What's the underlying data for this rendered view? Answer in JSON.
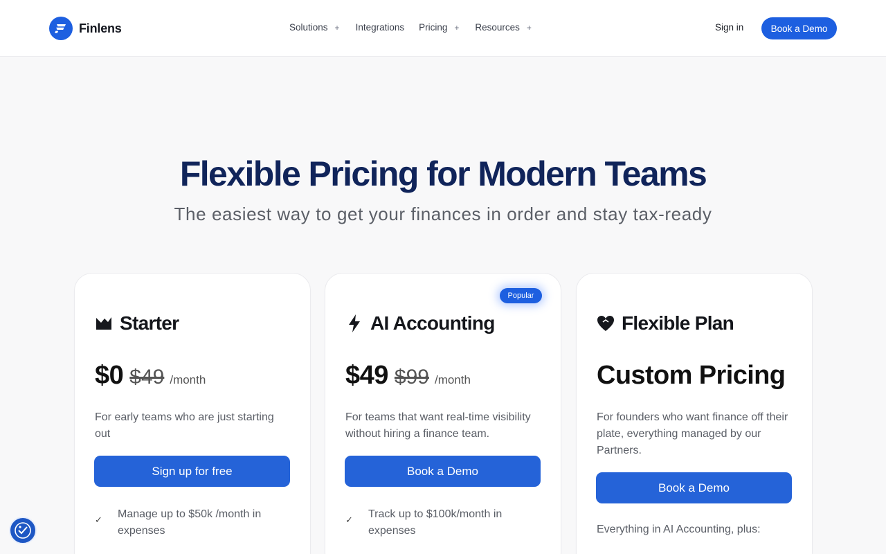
{
  "nav": {
    "brand": "Finlens",
    "links": [
      {
        "label": "Solutions",
        "has_plus": true
      },
      {
        "label": "Integrations",
        "has_plus": false
      },
      {
        "label": "Pricing",
        "has_plus": true
      },
      {
        "label": "Resources",
        "has_plus": true
      }
    ],
    "plus_glyph": "+",
    "signin": "Sign in",
    "demo": "Book a Demo"
  },
  "hero": {
    "title": "Flexible Pricing for Modern Teams",
    "subtitle": "The easiest way to get your finances in order and stay tax-ready"
  },
  "plans": [
    {
      "name": "Starter",
      "icon": "starter-flag-icon",
      "price": "$0",
      "old_price": "$49",
      "period": "/month",
      "desc": "For early teams who are just starting out",
      "cta": "Sign up for free",
      "feature": "Manage up to $50k /month in expenses"
    },
    {
      "name": "AI Accounting",
      "icon": "lightning-icon",
      "badge": "Popular",
      "price": "$49",
      "old_price": "$99",
      "period": "/month",
      "desc": "For teams that want real-time visibility without hiring a finance team.",
      "cta": "Book a Demo",
      "feature": "Track up to $100k/month in expenses"
    },
    {
      "name": "Flexible Plan",
      "icon": "heart-icon",
      "price_label": "Custom Pricing",
      "desc": "For founders who want finance off their plate,  everything managed by our Partners.",
      "cta": "Book a Demo",
      "plus_text": "Everything in AI Accounting, plus:"
    }
  ],
  "check_glyph": "✓",
  "colors": {
    "brand": "#1d5fe0",
    "title": "#10245a",
    "button": "#2563d8"
  }
}
